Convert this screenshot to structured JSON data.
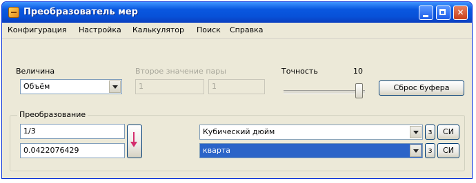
{
  "window": {
    "title": "Преобразователь мер"
  },
  "menu": {
    "items": [
      "Конфигурация",
      "Настройка",
      "Калькулятор",
      "Поиск",
      "Справка"
    ]
  },
  "top": {
    "quantity_label": "Величина",
    "quantity_value": "Объём",
    "disabled_label": "Второе значение пары",
    "disabled_field_1": "1",
    "disabled_field_2": "1",
    "precision_label": "Точность",
    "precision_value": "10",
    "reset_button": "Сброс буфера"
  },
  "convert": {
    "group_label": "Преобразование",
    "input_value": "1/3",
    "output_value": "0.0422076429",
    "from_unit": "Кубический дюйм",
    "to_unit": "кварта",
    "small_button": "з",
    "si_label": "СИ"
  },
  "icons": [
    "app-icon",
    "minimize-icon",
    "maximize-icon",
    "close-icon",
    "chevron-down-icon",
    "swap-arrow-icon"
  ],
  "colors": {
    "titlebar": "#0a58e0",
    "selection": "#2b64c8",
    "swap_arrow": "#d42d6d"
  }
}
